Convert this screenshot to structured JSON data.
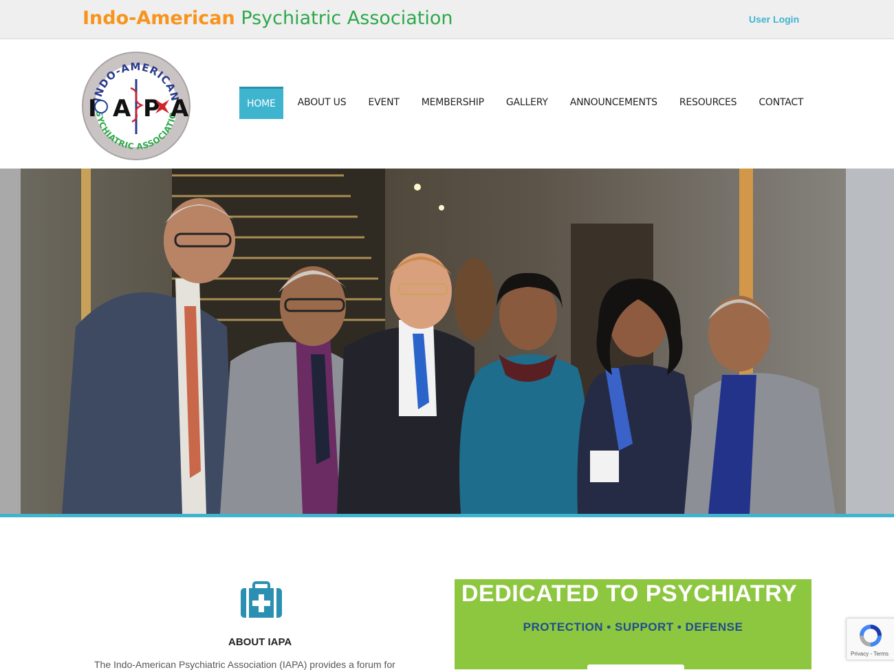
{
  "header": {
    "title_part1": "Indo-American",
    "title_part2": "Psychiatric Association",
    "user_login": "User Login"
  },
  "logo": {
    "ring_top": "INDO-AMERICAN",
    "ring_bottom": "PSYCHIATRIC ASSOCIATION",
    "letters": [
      "I",
      "A",
      "P",
      "A"
    ]
  },
  "nav": {
    "items": [
      "HOME",
      "ABOUT US",
      "EVENT",
      "MEMBERSHIP",
      "GALLERY",
      "ANNOUNCEMENTS",
      "RESOURCES",
      "CONTACT"
    ],
    "active": "HOME"
  },
  "about": {
    "icon": "medical-kit-icon",
    "title": "ABOUT IAPA",
    "text": "The Indo-American Psychiatric Association (IAPA) provides a forum for"
  },
  "promo": {
    "headline": "DEDICATED TO PSYCHIATRY",
    "tagline": "PROTECTION • SUPPORT • DEFENSE"
  },
  "recaptcha": {
    "links": "Privacy - Terms"
  },
  "colors": {
    "accent": "#3fb4cf",
    "orange": "#f7941d",
    "green": "#2ea84b",
    "promo_green": "#8dc63f",
    "promo_blue": "#1f4e8c"
  }
}
